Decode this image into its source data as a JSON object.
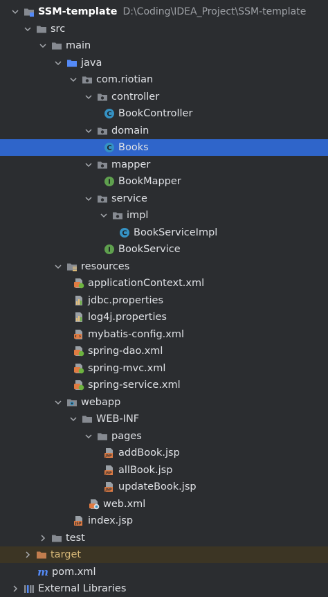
{
  "project": {
    "name": "SSM-template",
    "path": "D:\\Coding\\IDEA_Project\\SSM-template"
  },
  "tree": {
    "src": "src",
    "main": "main",
    "java": "java",
    "package": "com.riotian",
    "controller": "controller",
    "book_controller": "BookController",
    "domain": "domain",
    "books": "Books",
    "mapper": "mapper",
    "book_mapper": "BookMapper",
    "service": "service",
    "impl": "impl",
    "book_service_impl": "BookServiceImpl",
    "book_service": "BookService",
    "resources": "resources",
    "application_context": "applicationContext.xml",
    "jdbc_properties": "jdbc.properties",
    "log4j_properties": "log4j.properties",
    "mybatis_config": "mybatis-config.xml",
    "spring_dao": "spring-dao.xml",
    "spring_mvc": "spring-mvc.xml",
    "spring_service": "spring-service.xml",
    "webapp": "webapp",
    "web_inf": "WEB-INF",
    "pages": "pages",
    "add_book": "addBook.jsp",
    "all_book": "allBook.jsp",
    "update_book": "updateBook.jsp",
    "web_xml": "web.xml",
    "index_jsp": "index.jsp",
    "test": "test",
    "target": "target",
    "pom": "pom.xml",
    "external_libraries": "External Libraries"
  },
  "colors": {
    "background": "#2b2d30",
    "selection": "#2f65ca",
    "folder": "#868a91",
    "source_folder": "#548af7",
    "excluded_folder": "#c27d4e",
    "class_icon": "#3592c4",
    "interface_icon": "#5fa04e",
    "xml_icon": "#e07b42"
  },
  "icons": {
    "project": "module-folder-icon",
    "folder": "folder-icon",
    "package": "package-icon",
    "class": "class-icon",
    "interface": "interface-icon",
    "xml": "xml-file-icon",
    "spring_xml": "spring-xml-icon",
    "properties": "properties-file-icon",
    "jsp": "jsp-file-icon",
    "maven": "maven-icon",
    "libraries": "libraries-icon"
  }
}
